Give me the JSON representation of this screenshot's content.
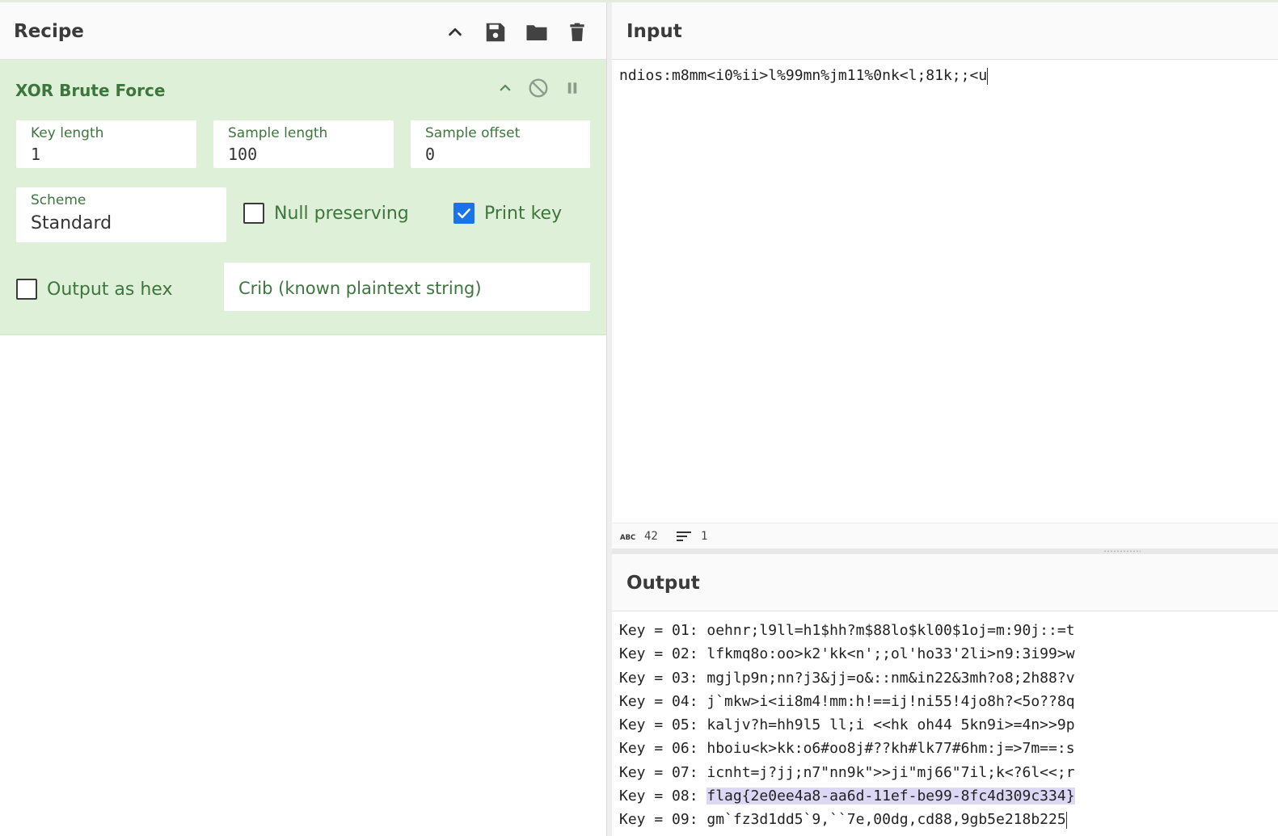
{
  "recipe": {
    "title": "Recipe",
    "operation": {
      "title": "XOR Brute Force",
      "fields": {
        "key_length": {
          "label": "Key length",
          "value": "1"
        },
        "sample_length": {
          "label": "Sample length",
          "value": "100"
        },
        "sample_offset": {
          "label": "Sample offset",
          "value": "0"
        },
        "scheme": {
          "label": "Scheme",
          "value": "Standard"
        }
      },
      "checkboxes": {
        "null_preserving": {
          "label": "Null preserving",
          "checked": false
        },
        "print_key": {
          "label": "Print key",
          "checked": true
        },
        "output_as_hex": {
          "label": "Output as hex",
          "checked": false
        }
      },
      "crib": {
        "placeholder": "Crib (known plaintext string)"
      }
    }
  },
  "input": {
    "title": "Input",
    "text": "ndios:m8mm<i0%ii>l%99mn%jm11%0nk<l;81k;;<u",
    "status": {
      "chars": "42",
      "lines": "1"
    }
  },
  "output": {
    "title": "Output",
    "lines": [
      {
        "key": "Key = 01: ",
        "text": "oehnr;l9ll=h1$hh?m$88lo$kl00$1oj=m:90j::=t"
      },
      {
        "key": "Key = 02: ",
        "text": "lfkmq8o:oo>k2'kk<n';;ol'ho33'2li>n9:3i99>w"
      },
      {
        "key": "Key = 03: ",
        "text": "mgjlp9n;nn?j3&jj=o&::nm&in22&3mh?o8;2h88?v"
      },
      {
        "key": "Key = 04: ",
        "text": "j`mkw>i<ii8m4!mm:h!==ij!ni55!4jo8h?<5o??8q"
      },
      {
        "key": "Key = 05: ",
        "text": "kaljv?h=hh9l5 ll;i <<hk oh44 5kn9i>=4n>>9p"
      },
      {
        "key": "Key = 06: ",
        "text": "hboiu<k>kk:o6#oo8j#??kh#lk77#6hm:j=>7m==:s"
      },
      {
        "key": "Key = 07: ",
        "text": "icnht=j?jj;n7\"nn9k\">>ji\"mj66\"7il;k<?6l<<;r"
      },
      {
        "key": "Key = 08: ",
        "text": "flag{2e0ee4a8-aa6d-11ef-be99-8fc4d309c334}"
      },
      {
        "key": "Key = 09: ",
        "text": "gm`fz3d1dd5`9,``7e,00dg,cd88,9gb5e218b225"
      }
    ]
  }
}
